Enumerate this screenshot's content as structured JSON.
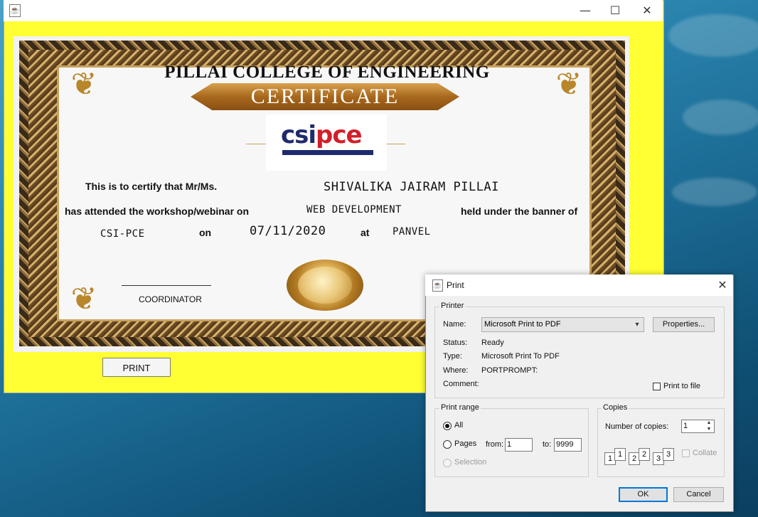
{
  "main_window": {
    "certificate": {
      "college": "PILLAI COLLEGE OF ENGINEERING",
      "banner": "CERTIFICATE",
      "logo_part1": "csi",
      "logo_part2": "pce",
      "line1_prefix": "This is to certify that Mr/Ms.",
      "name": "SHIVALIKA JAIRAM PILLAI",
      "line2_prefix": "has attended the workshop/webinar on",
      "event": "WEB DEVELOPMENT",
      "line2_suffix": "held under the banner of",
      "banner_org": "CSI-PCE",
      "on_label": "on",
      "date": "07/11/2020",
      "at_label": "at",
      "venue": "PANVEL",
      "coordinator": "COORDINATOR"
    },
    "print_button": "PRINT",
    "controls": {
      "minimize": "—",
      "maximize": "☐",
      "close": "✕"
    }
  },
  "print_dialog": {
    "title": "Print",
    "close": "✕",
    "printer": {
      "legend": "Printer",
      "name_label": "Name:",
      "name_value": "Microsoft Print to PDF",
      "properties_button": "Properties...",
      "status_label": "Status:",
      "status_value": "Ready",
      "type_label": "Type:",
      "type_value": "Microsoft Print To PDF",
      "where_label": "Where:",
      "where_value": "PORTPROMPT:",
      "comment_label": "Comment:",
      "print_to_file": "Print to file"
    },
    "print_range": {
      "legend": "Print range",
      "all": "All",
      "pages": "Pages",
      "from_label": "from:",
      "from_value": "1",
      "to_label": "to:",
      "to_value": "9999",
      "selection": "Selection"
    },
    "copies": {
      "legend": "Copies",
      "number_label": "Number of copies:",
      "number_value": "1",
      "collate": "Collate",
      "icon_labels": [
        "1",
        "1",
        "2",
        "2",
        "3",
        "3"
      ]
    },
    "ok_button": "OK",
    "cancel_button": "Cancel"
  }
}
